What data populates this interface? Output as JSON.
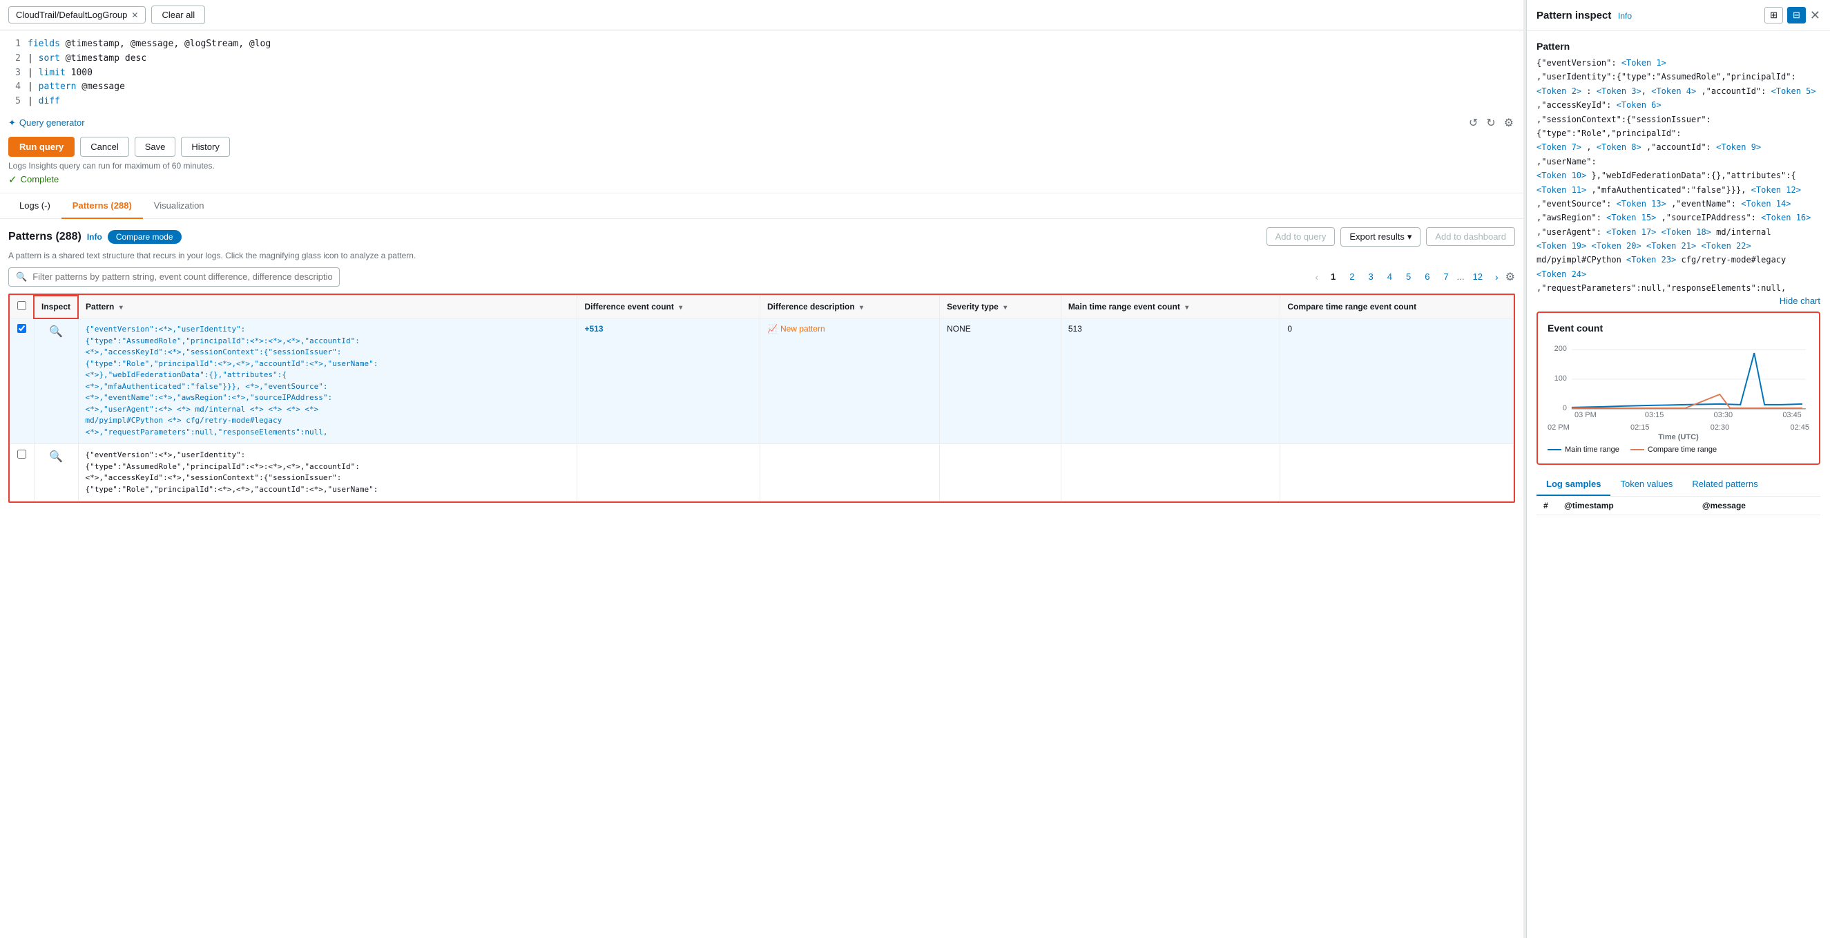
{
  "topBar": {
    "logGroupLabel": "CloudTrail/DefaultLogGroup",
    "clearAllLabel": "Clear all"
  },
  "queryEditor": {
    "lines": [
      {
        "ln": "1",
        "text": "fields @timestamp, @message, @logStream, @log"
      },
      {
        "ln": "2",
        "text": "| sort @timestamp desc"
      },
      {
        "ln": "3",
        "text": "| limit 1000"
      },
      {
        "ln": "4",
        "text": "| pattern @message"
      },
      {
        "ln": "5",
        "text": "| diff"
      }
    ],
    "queryGeneratorLabel": "Query generator",
    "runLabel": "Run query",
    "cancelLabel": "Cancel",
    "saveLabel": "Save",
    "historyLabel": "History",
    "infoText": "Logs Insights query can run for maximum of 60 minutes.",
    "completeLabel": "Complete"
  },
  "tabs": [
    {
      "id": "logs",
      "label": "Logs (-)"
    },
    {
      "id": "patterns",
      "label": "Patterns (288)",
      "active": true
    },
    {
      "id": "visualization",
      "label": "Visualization"
    }
  ],
  "patterns": {
    "title": "Patterns",
    "count": "(288)",
    "infoLabel": "Info",
    "compareModeLabel": "Compare mode",
    "descriptionText": "A pattern is a shared text structure that recurs in your logs. Click the magnifying glass icon to analyze a pattern.",
    "searchPlaceholder": "Filter patterns by pattern string, event count difference, difference description or keywords",
    "addToQueryLabel": "Add to query",
    "exportResultsLabel": "Export results",
    "addToDashboardLabel": "Add to dashboard",
    "pagination": {
      "pages": [
        "1",
        "2",
        "3",
        "4",
        "5",
        "6",
        "7"
      ],
      "dots": "...",
      "lastPage": "12",
      "currentPage": "1"
    },
    "tableHeaders": {
      "inspect": "Inspect",
      "pattern": "Pattern",
      "differenceEventCount": "Difference event count",
      "differenceDescription": "Difference description",
      "severityType": "Severity type",
      "mainTimeRangeEventCount": "Main time range event count",
      "compareTimeRangeEventCount": "Compare time range event count"
    },
    "rows": [
      {
        "id": "row1",
        "selected": true,
        "patternText": "{\"eventVersion\":<*>,\"userIdentity\":\n{\"type\":\"AssumedRole\",\"principalId\":<*>:<*>,<*>,\"accountId\":\n<*>,\"accessKeyId\":<*>,\"sessionContext\":{\"sessionIssuer\":\n{\"type\":\"Role\",\"principalId\":<*>,<*>,\"accountId\":<*>,\"userName\":\n<*>},\"webIdFederationData\":{},\"attributes\":{\n<*>,\"mfaAuthenticated\":\"false\"}}}, <*>,\"eventSource\":\n<*>,\"eventName\":<*>,\"awsRegion\":<*>,\"sourceIPAddress\":\n<*>,\"userAgent\":<*> <*> md/internal <*> <*> <*> <*>\nmd/pyimpl#CPython <*> cfg/retry-mode#legacy\n<*>,\"requestParameters\":null,\"responseElements\":null,",
        "diffCount": "+513",
        "diffDescription": "New pattern",
        "severityType": "NONE",
        "mainEventCount": "513",
        "compareEventCount": "0"
      },
      {
        "id": "row2",
        "selected": false,
        "patternText": "{\"eventVersion\":<*>,\"userIdentity\":\n{\"type\":\"AssumedRole\",\"principalId\":<*>:<*>,<*>,\"accountId\":\n<*>,\"accessKeyId\":<*>,\"sessionContext\":{\"sessionIssuer\":\n{\"type\":\"Role\",\"principalId\":<*>,<*>,\"accountId\":<*>,\"userName\":",
        "diffCount": "",
        "diffDescription": "",
        "severityType": "",
        "mainEventCount": "",
        "compareEventCount": ""
      }
    ]
  },
  "rightPanel": {
    "title": "Pattern inspect",
    "infoLabel": "Info",
    "patternLabel": "Pattern",
    "patternJson": "{\"eventVersion\": <Token 1>\n,\"userIdentity\":{\"type\":\"AssumedRole\",\"principalId\":\n<Token 2> : <Token 3>, <Token 4> ,\"accountId\": <Token 5>\n,\"accessKeyId\": <Token 6>\n,\"sessionContext\":{\"sessionIssuer\":{\"type\":\"Role\",\"principalId\":\n<Token 7> , <Token 8> ,\"accountId\": <Token 9> ,\"userName\":\n<Token 10> },\"webIdFederationData\":{},\"attributes\":{\n<Token 11> ,\"mfaAuthenticated\":\"false\"}}}, <Token 12>\n,\"eventSource\": <Token 13> ,\"eventName\": <Token 14>\n,\"awsRegion\": <Token 15> ,\"sourceIPAddress\": <Token 16>\n,\"userAgent\": <Token 17> <Token 18> md/internal\n<Token 19> <Token 20> <Token 21> <Token 22>\nmd/pyimpl#CPython <Token 23> cfg/retry-mode#legacy\n<Token 24>\n,\"requestParameters\":null,\"responseElements\":null,",
    "tokens": [
      "Token 1",
      "Token 2",
      "Token 3",
      "Token 4",
      "Token 5",
      "Token 6",
      "Token 7",
      "Token 8",
      "Token 9",
      "Token 10",
      "Token 11",
      "Token 12",
      "Token 13",
      "Token 14",
      "Token 15",
      "Token 16",
      "Token 17",
      "Token 18",
      "Token 19",
      "Token 20",
      "Token 21",
      "Token 22",
      "Token 23",
      "Token 24"
    ],
    "hideChartLabel": "Hide chart",
    "chart": {
      "title": "Event count",
      "yLabels": [
        "200",
        "100",
        "0"
      ],
      "xLabels": [
        "03 PM",
        "03:15",
        "03:30",
        "03:45"
      ],
      "xSubLabels": [
        "02 PM",
        "02:15",
        "02:30",
        "02:45"
      ],
      "mainTimeRangeLabel": "Main time range",
      "compareTimeRangeLabel": "Compare time range",
      "timeLabel": "Time (UTC)"
    },
    "bottomTabs": [
      {
        "id": "logSamples",
        "label": "Log samples",
        "active": true
      },
      {
        "id": "tokenValues",
        "label": "Token values"
      },
      {
        "id": "relatedPatterns",
        "label": "Related patterns"
      }
    ],
    "tableHeaders": {
      "hash": "#",
      "timestamp": "@timestamp",
      "message": "@message"
    }
  }
}
